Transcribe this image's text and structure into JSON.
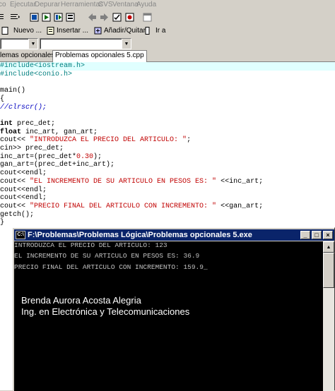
{
  "menu": [
    "co",
    "Ejecutar",
    "Depurar",
    "Herramientas",
    "CVS",
    "Ventana",
    "Ayuda"
  ],
  "toolbar2": {
    "new_label": "Nuevo ...",
    "insert_label": "Insertar ...",
    "add_remove_label": "Añadir/Quitar",
    "goto_label": "Ir a"
  },
  "tabs": [
    "lemas opcionales 4.cpp",
    "Problemas opcionales 5.cpp"
  ],
  "code": {
    "l1": "#include<iostream.h>",
    "l2": "#include<conio.h>",
    "l3": "main()",
    "l4": "{",
    "l5": "//clrscr();",
    "l6a": "int",
    "l6b": " prec_det;",
    "l7a": "float",
    "l7b": " inc_art, gan_art;",
    "l8a": "cout<< ",
    "l8b": "\"INTRODUZCA EL PRECIO DEL ARTICULO: \"",
    "l8c": ";",
    "l9": "cin>> prec_det;",
    "l10a": "inc_art=(prec_det*",
    "l10b": "0.30",
    "l10c": ");",
    "l11": "gan_art=(prec_det+inc_art);",
    "l12": "cout<<endl;",
    "l13a": "cout<< ",
    "l13b": "\"EL INCREMENTO DE SU ARTICULO EN PESOS ES: \"",
    "l13c": " <<inc_art;",
    "l14": "cout<<endl;",
    "l15": "cout<<endl;",
    "l16a": "cout<< ",
    "l16b": "\"PRECIO FINAL DEL ARTICULO CON INCREMENTO: \"",
    "l16c": " <<gan_art;",
    "l17": "getch();",
    "l18": "}"
  },
  "console": {
    "title": "F:\\Problemas\\Problemas Lógica\\Problemas opcionales 5.exe",
    "icon_text": "C:\\",
    "line1": "INTRODUZCA EL PRECIO DEL ARTICULO: 123",
    "line2": "EL INCREMENTO DE SU ARTICULO EN PESOS ES: 36.9",
    "line3": "PRECIO FINAL DEL ARTICULO CON INCREMENTO: 159.9_",
    "author": "Brenda Aurora Acosta Alegria",
    "degree": "Ing. en Electrónica y Telecomunicaciones"
  }
}
